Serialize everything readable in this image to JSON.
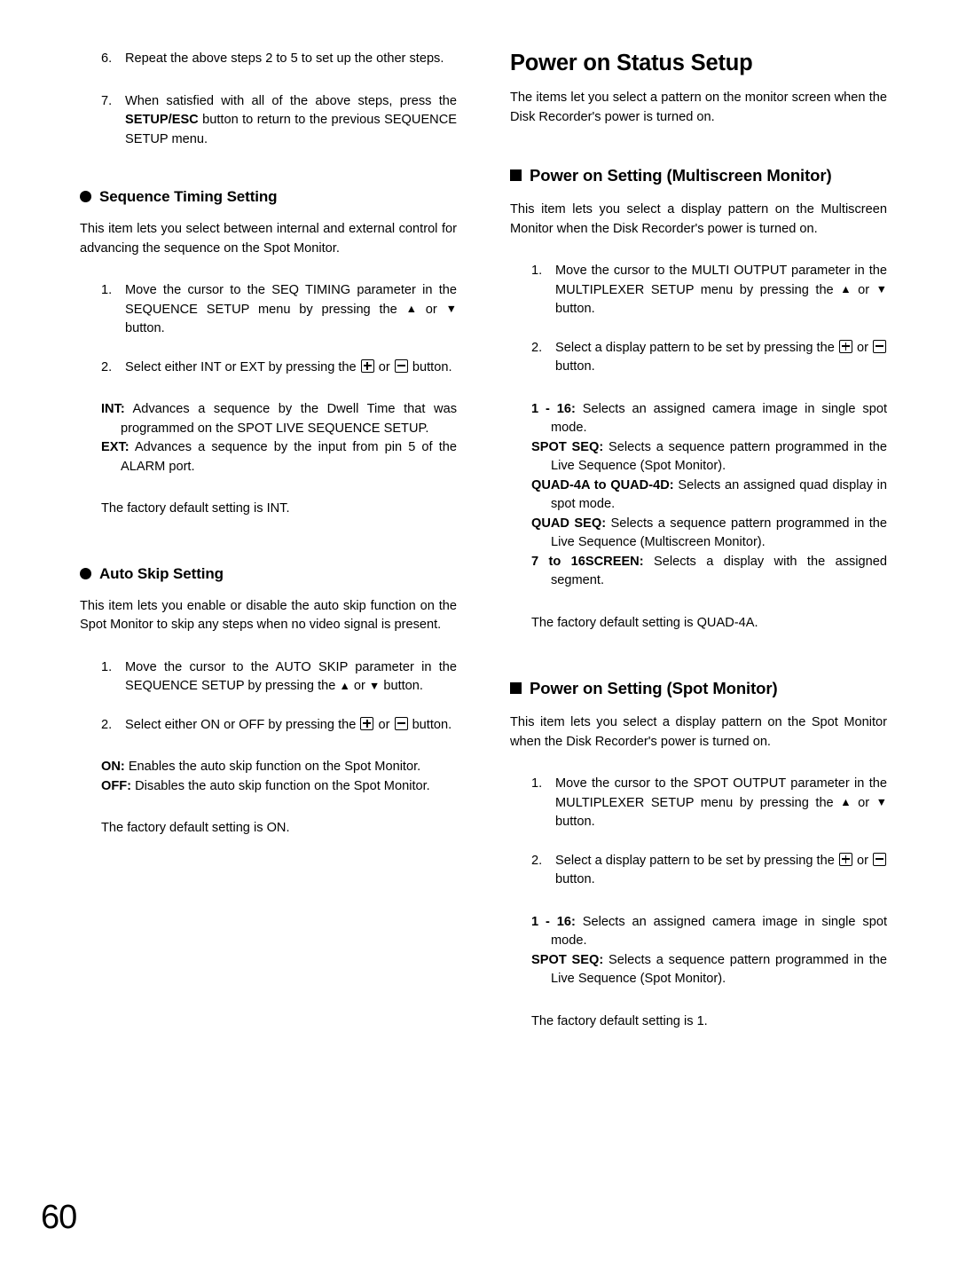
{
  "page": {
    "number": "60"
  },
  "left_column": {
    "steps_continued": [
      {
        "num": "6.",
        "text": "Repeat the above steps 2 to 5 to set up the other steps."
      },
      {
        "num": "7.",
        "text_before": "When satisfied with all of the above steps, press the ",
        "bold": "SETUP/ESC",
        "text_after": " button to return to the previous SEQUENCE SETUP menu."
      }
    ],
    "section_seq_timing": {
      "heading": "Sequence Timing Setting",
      "intro": "This item lets you select between internal and external control for advancing the sequence on the Spot Monitor.",
      "steps": [
        {
          "num": "1.",
          "part_a": "Move the cursor to the SEQ TIMING parameter in the SEQUENCE SETUP menu by pressing the ",
          "arrow_up": "▲",
          "mid": " or ",
          "arrow_down": "▼",
          "part_b": " button."
        },
        {
          "num": "2.",
          "part_a": "Select either INT or EXT by pressing the ",
          "key_plus": "plus-key-icon",
          "mid": " or ",
          "key_minus": "minus-key-icon",
          "part_b": " button."
        }
      ],
      "definitions": [
        {
          "term": "INT:",
          "desc": "Advances a sequence by the Dwell Time that was programmed on the SPOT LIVE SEQUENCE SETUP."
        },
        {
          "term": "EXT:",
          "desc": "Advances a sequence by the input from pin 5 of the ALARM port."
        }
      ],
      "default_note": "The factory default setting is INT."
    },
    "section_auto_skip": {
      "heading": "Auto Skip Setting",
      "intro": "This item lets you enable or disable the auto skip function on the Spot Monitor to skip any steps when no video signal is present.",
      "steps": [
        {
          "num": "1.",
          "part_a": "Move the cursor to the AUTO SKIP parameter in the SEQUENCE SETUP by pressing the ",
          "arrow_up": "▲",
          "mid": " or ",
          "arrow_down": "▼",
          "part_b": " button."
        },
        {
          "num": "2.",
          "part_a": "Select either ON or OFF by pressing the ",
          "key_plus": "plus-key-icon",
          "mid": " or ",
          "key_minus": "minus-key-icon",
          "part_b": " button."
        }
      ],
      "definitions": [
        {
          "term": "ON:",
          "desc": "Enables the auto skip function on the Spot Monitor."
        },
        {
          "term": "OFF:",
          "desc": "Disables the auto skip function on the Spot Monitor."
        }
      ],
      "default_note": "The factory default setting is ON."
    }
  },
  "right_column": {
    "chapter_title": "Power on Status Setup",
    "chapter_intro": "The items let you select a pattern on the monitor screen when the Disk Recorder's power is turned on.",
    "section_multiscreen": {
      "heading": "Power on Setting (Multiscreen Monitor)",
      "intro": "This item lets you select a display pattern on the Multiscreen Monitor when the Disk Recorder's power is turned on.",
      "steps": [
        {
          "num": "1.",
          "part_a": "Move the cursor to the MULTI OUTPUT parameter in the MULTIPLEXER SETUP menu by pressing the ",
          "arrow_up": "▲",
          "mid": " or ",
          "arrow_down": "▼",
          "part_b": " button."
        },
        {
          "num": "2.",
          "part_a": "Select a display pattern to be set by pressing the ",
          "key_plus": "plus-key-icon",
          "mid": " or ",
          "key_minus": "minus-key-icon",
          "part_b": " button."
        }
      ],
      "definitions": [
        {
          "term": "1 - 16:",
          "desc": "Selects an assigned camera image in single spot mode."
        },
        {
          "term": "SPOT SEQ:",
          "desc": "Selects a sequence pattern programmed in the Live Sequence (Spot Monitor)."
        },
        {
          "term": "QUAD-4A to QUAD-4D:",
          "desc": "Selects an assigned quad display in spot mode."
        },
        {
          "term": "QUAD SEQ:",
          "desc": "Selects a sequence pattern programmed in the Live Sequence (Multiscreen Monitor)."
        },
        {
          "term": "7 to 16SCREEN:",
          "desc": "Selects a display with the assigned segment."
        }
      ],
      "default_note": "The factory default setting is QUAD-4A."
    },
    "section_spot": {
      "heading": "Power on Setting (Spot Monitor)",
      "intro": "This item lets you select a display pattern on the Spot Monitor when the Disk Recorder's power is turned on.",
      "steps": [
        {
          "num": "1.",
          "part_a": "Move the cursor to the SPOT OUTPUT parameter in the MULTIPLEXER SETUP menu by pressing the ",
          "arrow_up": "▲",
          "mid": " or ",
          "arrow_down": "▼",
          "part_b": " button."
        },
        {
          "num": "2.",
          "part_a": "Select a display pattern to be set by pressing the ",
          "key_plus": "plus-key-icon",
          "mid": " or ",
          "key_minus": "minus-key-icon",
          "part_b": " button."
        }
      ],
      "definitions": [
        {
          "term": "1 - 16:",
          "desc": "Selects an assigned camera image in single spot mode."
        },
        {
          "term": "SPOT SEQ:",
          "desc": "Selects a sequence pattern programmed in the Live Sequence (Spot Monitor)."
        }
      ],
      "default_note": "The factory default setting is 1."
    }
  }
}
